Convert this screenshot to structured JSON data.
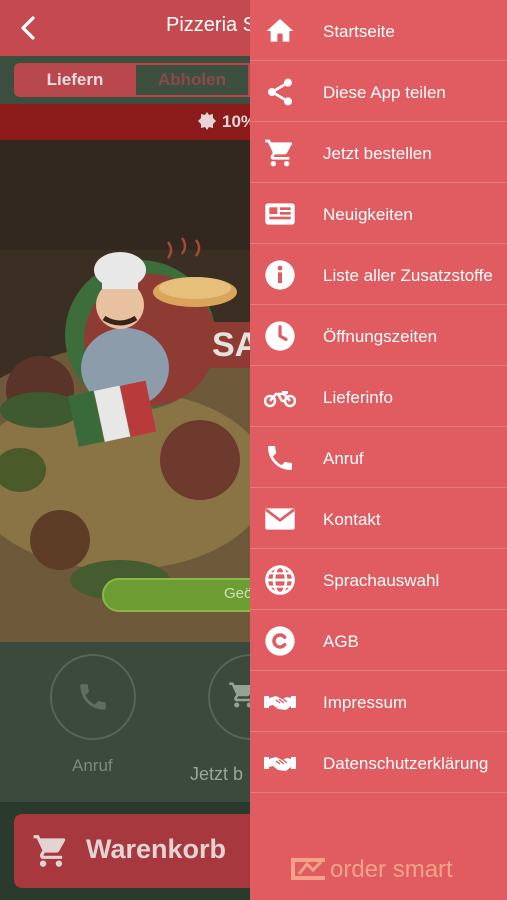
{
  "app": {
    "title": "Pizzeria S",
    "back_icon": "chevron-left-icon",
    "tabs": {
      "deliver": "Liefern",
      "pickup": "Abholen"
    },
    "promo": {
      "text": "10%",
      "icon": "badge-icon"
    },
    "hero": {
      "brand_text": "SA",
      "status_text": "Geö"
    },
    "actions": {
      "call_label": "Anruf",
      "order_label": "Jetzt b"
    },
    "cart": {
      "label": "Warenkorb",
      "icon": "cart-icon"
    }
  },
  "menu": {
    "items": [
      {
        "label": "Startseite",
        "icon": "home-icon"
      },
      {
        "label": "Diese App teilen",
        "icon": "share-icon"
      },
      {
        "label": "Jetzt bestellen",
        "icon": "cart-icon"
      },
      {
        "label": "Neuigkeiten",
        "icon": "newspaper-icon"
      },
      {
        "label": "Liste aller Zusatzstoffe",
        "icon": "info-icon"
      },
      {
        "label": "Öffnungszeiten",
        "icon": "clock-icon"
      },
      {
        "label": "Lieferinfo",
        "icon": "motorcycle-icon"
      },
      {
        "label": "Anruf",
        "icon": "phone-icon"
      },
      {
        "label": "Kontakt",
        "icon": "envelope-icon"
      },
      {
        "label": "Sprachauswahl",
        "icon": "globe-icon"
      },
      {
        "label": "AGB",
        "icon": "copyright-icon"
      },
      {
        "label": "Impressum",
        "icon": "handshake-icon"
      },
      {
        "label": "Datenschutzerklärung",
        "icon": "handshake-icon"
      }
    ],
    "footer_logo": "order smart"
  },
  "colors": {
    "drawer_bg": "#e05c61",
    "topbar": "#c44a4f",
    "promo_bar": "#8c1c1c",
    "open_pill": "#6d9c33",
    "footer_logo": "#f4a28a"
  }
}
